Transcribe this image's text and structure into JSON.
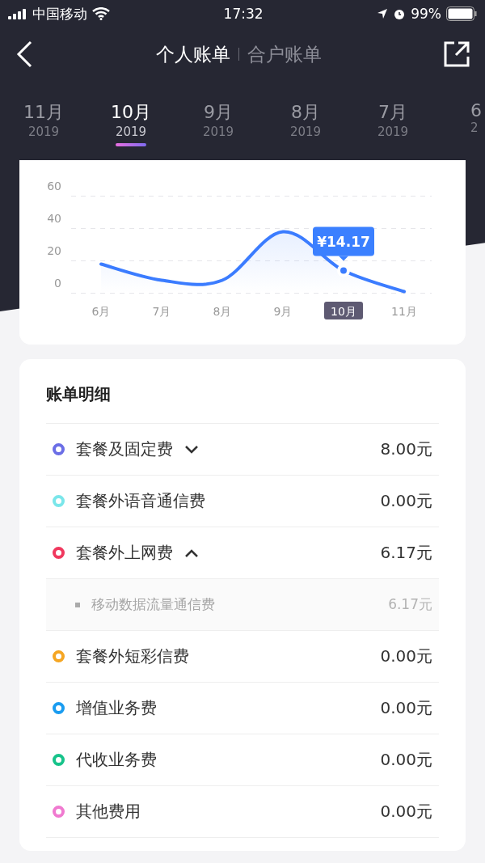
{
  "status_bar": {
    "carrier": "中国移动",
    "time": "17:32",
    "battery": "99%"
  },
  "header": {
    "tabs": [
      {
        "label": "个人账单",
        "selected": true
      },
      {
        "label": "合户账单",
        "selected": false
      }
    ]
  },
  "months": [
    {
      "month": "11月",
      "year": "2019",
      "selected": false
    },
    {
      "month": "10月",
      "year": "2019",
      "selected": true
    },
    {
      "month": "9月",
      "year": "2019",
      "selected": false
    },
    {
      "month": "8月",
      "year": "2019",
      "selected": false
    },
    {
      "month": "7月",
      "year": "2019",
      "selected": false
    },
    {
      "month": "6",
      "year": "2",
      "selected": false
    }
  ],
  "chart": {
    "chart_data": {
      "type": "line",
      "categories": [
        "6月",
        "7月",
        "8月",
        "9月",
        "10月",
        "11月"
      ],
      "series": [
        {
          "color": "#3b7cff",
          "values": [
            18,
            8,
            8,
            38,
            14,
            1
          ]
        }
      ],
      "ylim": [
        0,
        60
      ],
      "yticks": [
        0,
        20,
        40,
        60
      ],
      "annotations": [
        "¥14.17"
      ]
    }
  },
  "details": {
    "title": "账单明细",
    "items": [
      {
        "kind": "group",
        "label": "套餐及固定费",
        "amount": "8.00元",
        "color": "#6b6ee6",
        "expanded": false
      },
      {
        "kind": "plain",
        "label": "套餐外语音通信费",
        "amount": "0.00元",
        "color": "#7ae6ea"
      },
      {
        "kind": "group",
        "label": "套餐外上网费",
        "amount": "6.17元",
        "color": "#f0385e",
        "expanded": true,
        "children": [
          {
            "label": "移动数据流量通信费",
            "amount": "6.17元"
          }
        ]
      },
      {
        "kind": "plain",
        "label": "套餐外短彩信费",
        "amount": "0.00元",
        "color": "#f5a623"
      },
      {
        "kind": "plain",
        "label": "增值业务费",
        "amount": "0.00元",
        "color": "#1a9cf0"
      },
      {
        "kind": "plain",
        "label": "代收业务费",
        "amount": "0.00元",
        "color": "#17c38a"
      },
      {
        "kind": "plain",
        "label": "其他费用",
        "amount": "0.00元",
        "color": "#f07ad0"
      }
    ]
  }
}
